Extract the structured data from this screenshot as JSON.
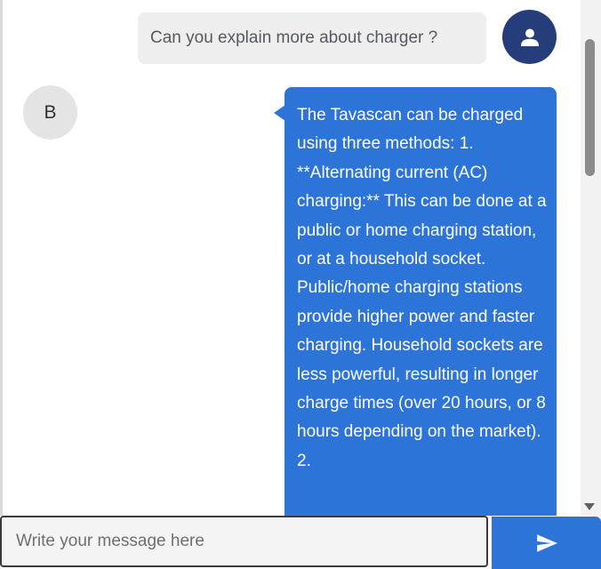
{
  "conversation": {
    "user_message": {
      "text": "Can you explain more about charger ?",
      "avatar_icon": "user-icon"
    },
    "bot_message": {
      "avatar_letter": "B",
      "text": "The Tavascan can be charged using three methods: 1. **Alternating current (AC) charging:** This can be done at a public or home charging station, or at a household socket. Public/home charging stations provide higher power and faster charging. Household sockets are less powerful, resulting in longer charge times (over 20 hours, or 8 hours depending on the market). 2."
    }
  },
  "composer": {
    "placeholder": "Write your message here",
    "value": "",
    "send_icon": "paper-plane-icon"
  },
  "colors": {
    "user_avatar": "#263d7c",
    "bot_bubble": "#2d74d8",
    "user_bubble": "#eeeeee",
    "send_button": "#2d74d8"
  }
}
